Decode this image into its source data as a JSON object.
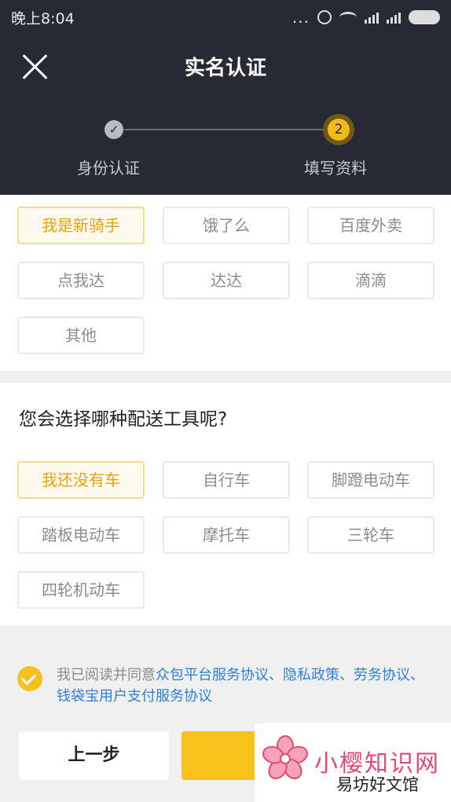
{
  "status_bar": {
    "time": "晚上8:04",
    "dots": "..."
  },
  "header": {
    "title": "实名认证",
    "steps": [
      {
        "label": "身份认证",
        "mark": "✓"
      },
      {
        "label": "填写资料",
        "number": "2"
      }
    ]
  },
  "platforms": {
    "options": [
      "我是新骑手",
      "饿了么",
      "百度外卖",
      "点我达",
      "达达",
      "滴滴",
      "其他"
    ],
    "selected": "我是新骑手"
  },
  "vehicles": {
    "question": "您会选择哪种配送工具呢?",
    "options": [
      "我还没有车",
      "自行车",
      "脚蹬电动车",
      "踏板电动车",
      "摩托车",
      "三轮车",
      "四轮机动车"
    ],
    "selected": "我还没有车"
  },
  "agreement": {
    "prefix": "我已阅读并同意",
    "links": [
      "众包平台服务协议",
      "隐私政策",
      "劳务协议",
      "钱袋宝用户支付服务协议"
    ],
    "separator": "、"
  },
  "buttons": {
    "prev_label": "上一步"
  },
  "watermark": {
    "line1": "小樱知识网",
    "line2": "易坊好文馆"
  },
  "colors": {
    "accent": "#f8c21c",
    "header_bg": "#272a34",
    "link": "#2e7fd6",
    "watermark_pink": "#e24a73"
  }
}
